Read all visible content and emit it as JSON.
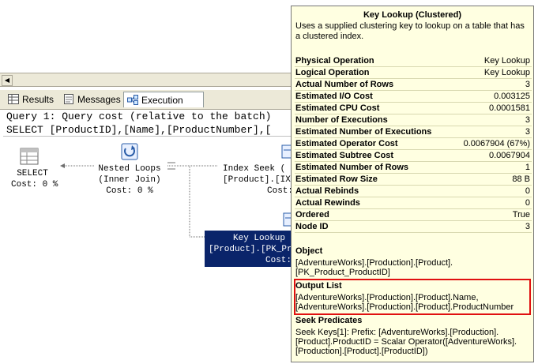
{
  "tabs": [
    {
      "label": "Results"
    },
    {
      "label": "Messages"
    },
    {
      "label": "Execution plan"
    }
  ],
  "plan": {
    "query_header": "Query 1: Query cost (relative to the batch)",
    "query_sql": "SELECT [ProductID],[Name],[ProductNumber],[",
    "nodes": {
      "select": {
        "line1": "SELECT",
        "line2": "Cost: 0 %"
      },
      "nested_loops": {
        "line1": "Nested Loops",
        "line2": "(Inner Join)",
        "line3": "Cost: 0 %"
      },
      "index_seek": {
        "line1": "Index Seek (",
        "line2": "[Product].[IX",
        "line3": "Cost:"
      },
      "key_lookup": {
        "line1": "Key Lookup",
        "line2": "[Product].[PK_Pr",
        "line3": "Cost:"
      }
    }
  },
  "tooltip": {
    "title": "Key Lookup (Clustered)",
    "description": "Uses a supplied clustering key to lookup on a table that has a clustered index.",
    "properties": [
      {
        "label": "Physical Operation",
        "value": "Key Lookup"
      },
      {
        "label": "Logical Operation",
        "value": "Key Lookup"
      },
      {
        "label": "Actual Number of Rows",
        "value": "3"
      },
      {
        "label": "Estimated I/O Cost",
        "value": "0.003125"
      },
      {
        "label": "Estimated CPU Cost",
        "value": "0.0001581"
      },
      {
        "label": "Number of Executions",
        "value": "3"
      },
      {
        "label": "Estimated Number of Executions",
        "value": "3"
      },
      {
        "label": "Estimated Operator Cost",
        "value": "0.0067904 (67%)"
      },
      {
        "label": "Estimated Subtree Cost",
        "value": "0.0067904"
      },
      {
        "label": "Estimated Number of Rows",
        "value": "1"
      },
      {
        "label": "Estimated Row Size",
        "value": "88 B"
      },
      {
        "label": "Actual Rebinds",
        "value": "0"
      },
      {
        "label": "Actual Rewinds",
        "value": "0"
      },
      {
        "label": "Ordered",
        "value": "True"
      },
      {
        "label": "Node ID",
        "value": "3"
      }
    ],
    "object": {
      "heading": "Object",
      "lines": [
        "[AdventureWorks].[Production].[Product].",
        "[PK_Product_ProductID]"
      ]
    },
    "output_list": {
      "heading": "Output List",
      "lines": [
        "[AdventureWorks].[Production].[Product].Name,",
        "[AdventureWorks].[Production].[Product].ProductNumber"
      ]
    },
    "seek_predicates": {
      "heading": "Seek Predicates",
      "lines": [
        "Seek Keys[1]: Prefix: [AdventureWorks].[Production].",
        "[Product].ProductID = Scalar Operator([AdventureWorks].",
        "[Production].[Product].[ProductID])"
      ]
    }
  },
  "colors": {
    "tooltip_bg": "#ffffe1",
    "highlight": "#e01010",
    "selected_node": "#0a246a"
  }
}
